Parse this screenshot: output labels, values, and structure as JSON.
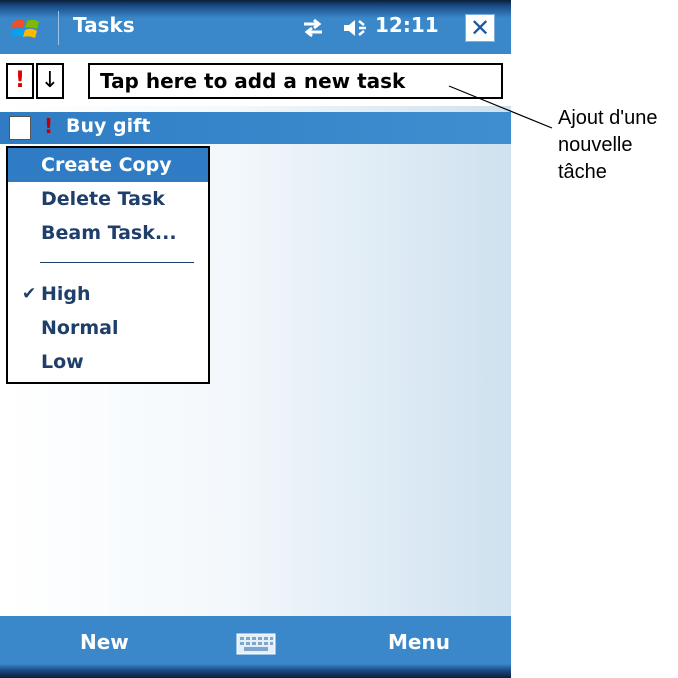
{
  "title_bar": {
    "app_title": "Tasks",
    "time": "12:11",
    "close_label": "✕",
    "icons": [
      "windows-start-icon",
      "connectivity-icon",
      "volume-icon"
    ]
  },
  "entry_bar": {
    "priority_label": "!",
    "sort_label": "↓",
    "new_task_placeholder": "Tap here to add a new task"
  },
  "task_list": {
    "items": [
      {
        "name": "Buy gift",
        "priority_marker": "!",
        "completed": false
      }
    ]
  },
  "context_menu": {
    "items": [
      {
        "label": "Create Copy",
        "selected": true
      },
      {
        "label": "Delete Task",
        "selected": false
      },
      {
        "label": "Beam Task...",
        "selected": false
      }
    ],
    "priority_items": [
      {
        "label": "High",
        "checked": true
      },
      {
        "label": "Normal",
        "checked": false
      },
      {
        "label": "Low",
        "checked": false
      }
    ],
    "check_glyph": "✔"
  },
  "bottom_bar": {
    "left_softkey": "New",
    "right_softkey": "Menu",
    "keyboard_icon": "keyboard-icon"
  },
  "annotation": {
    "lines": [
      "Ajout d'une",
      "nouvelle",
      "tâche"
    ]
  },
  "colors": {
    "accent_blue": "#3a87c9",
    "selection_blue": "#2f7cc4",
    "priority_red": "#e00000"
  }
}
